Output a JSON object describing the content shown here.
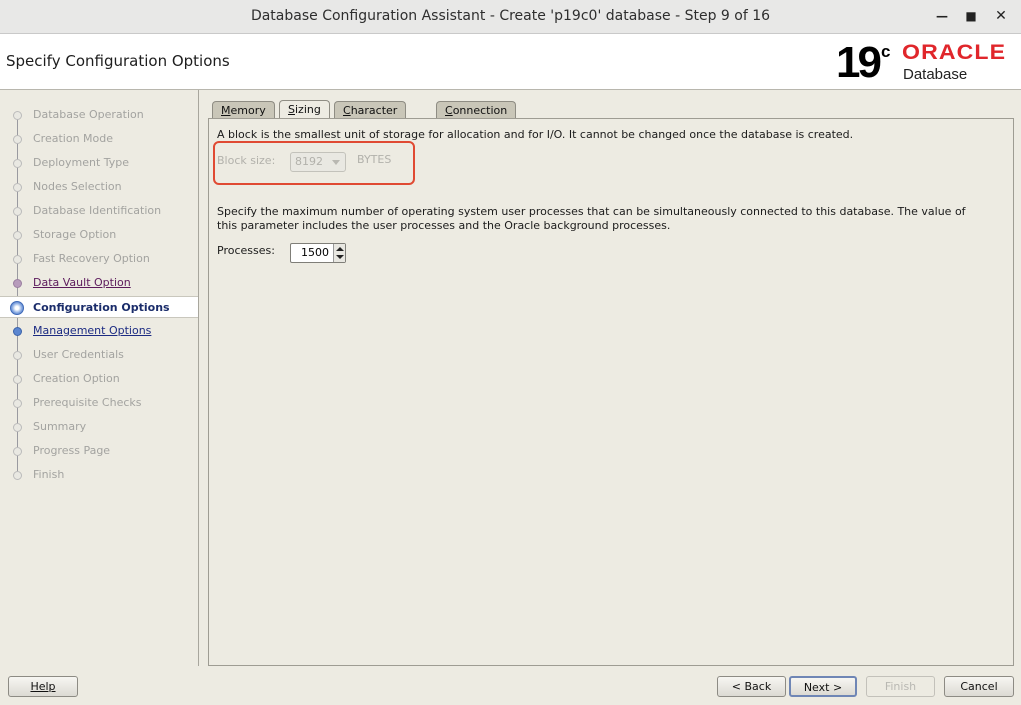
{
  "window": {
    "title": "Database Configuration Assistant - Create 'p19c0' database - Step 9 of 16",
    "controls": [
      "minimize",
      "maximize",
      "close"
    ]
  },
  "header": {
    "title": "Specify Configuration Options",
    "logo": {
      "version": "19",
      "sup": "c",
      "brand": "ORACLE",
      "product": "Database",
      "brand_color": "#e0262b"
    }
  },
  "steps": [
    {
      "label": "Database Operation",
      "state": "done"
    },
    {
      "label": "Creation Mode",
      "state": "done"
    },
    {
      "label": "Deployment Type",
      "state": "done"
    },
    {
      "label": "Nodes Selection",
      "state": "done"
    },
    {
      "label": "Database Identification",
      "state": "done"
    },
    {
      "label": "Storage Option",
      "state": "done"
    },
    {
      "label": "Fast Recovery Option",
      "state": "done"
    },
    {
      "label": "Data Vault Option",
      "state": "visited"
    },
    {
      "label": "Configuration Options",
      "state": "current"
    },
    {
      "label": "Management Options",
      "state": "link"
    },
    {
      "label": "User Credentials",
      "state": "pending"
    },
    {
      "label": "Creation Option",
      "state": "pending"
    },
    {
      "label": "Prerequisite Checks",
      "state": "pending"
    },
    {
      "label": "Summary",
      "state": "pending"
    },
    {
      "label": "Progress Page",
      "state": "pending"
    },
    {
      "label": "Finish",
      "state": "pending"
    }
  ],
  "tabs": [
    {
      "label": "Memory",
      "mnemonic": "M",
      "rest": "emory"
    },
    {
      "label": "Sizing",
      "mnemonic": "S",
      "rest": "izing",
      "active": true
    },
    {
      "label": "Character sets",
      "mnemonic": "C",
      "rest": "haracter sets"
    },
    {
      "label": "Connection mode",
      "mnemonic": "C",
      "rest": "onnection mode"
    }
  ],
  "sizing": {
    "block_desc": "A block is the smallest unit of storage for allocation and for I/O. It cannot be changed once the database is created.",
    "block_label": "Block size:",
    "block_value": "8192",
    "block_unit": "BYTES",
    "proc_desc_1": "Specify the maximum number of operating system user processes that can be simultaneously connected to this database. The value of",
    "proc_desc_2": "this parameter includes the user processes and the Oracle background processes.",
    "proc_label": "Processes:",
    "proc_value": "1500",
    "highlight_color": "#e04a33"
  },
  "footer": {
    "help": "Help",
    "back": "< Back",
    "next": "Next >",
    "finish": "Finish",
    "cancel": "Cancel"
  }
}
